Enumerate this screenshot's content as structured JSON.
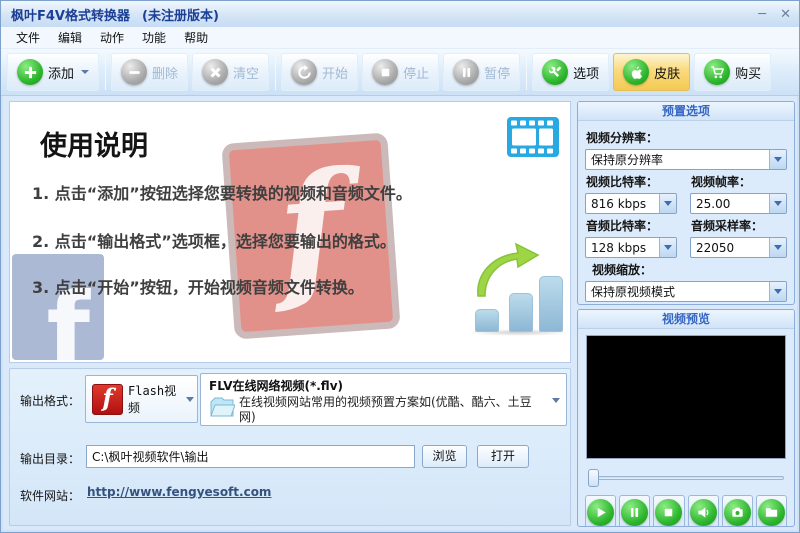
{
  "window": {
    "title": "枫叶F4V格式转换器",
    "title_suffix": "(未注册版本)",
    "minimize_glyph": "─",
    "close_glyph": "✕"
  },
  "menu": {
    "items": [
      "文件",
      "编辑",
      "动作",
      "功能",
      "帮助"
    ]
  },
  "toolbar": {
    "buttons": [
      {
        "label": "添加",
        "icon": "add-icon",
        "enabled": true,
        "dropdown": true
      },
      {
        "label": "删除",
        "icon": "remove-icon",
        "enabled": false
      },
      {
        "label": "清空",
        "icon": "clear-icon",
        "enabled": false
      },
      {
        "label": "开始",
        "icon": "start-icon",
        "enabled": false
      },
      {
        "label": "停止",
        "icon": "stop-icon",
        "enabled": false
      },
      {
        "label": "暂停",
        "icon": "pause-icon",
        "enabled": false
      },
      {
        "label": "选项",
        "icon": "options-icon",
        "enabled": true
      },
      {
        "label": "皮肤",
        "icon": "skin-icon",
        "enabled": true,
        "highlighted": true
      },
      {
        "label": "购买",
        "icon": "buy-icon",
        "enabled": true
      }
    ]
  },
  "instructions": {
    "heading": "使用说明",
    "steps": [
      "1. 点击“添加”按钮选择您要转换的视频和音频文件。",
      "2. 点击“输出格式”选项框，选择您要输出的格式。",
      "3. 点击“开始”按钮，开始视频音频文件转换。"
    ]
  },
  "presets": {
    "title": "预置选项",
    "resolution_label": "视频分辨率：",
    "resolution_value": "保持原分辨率",
    "video_bitrate_label": "视频比特率：",
    "video_bitrate_value": "816 kbps",
    "framerate_label": "视频帧率：",
    "framerate_value": "25.00",
    "audio_bitrate_label": "音频比特率：",
    "audio_bitrate_value": "128 kbps",
    "sample_rate_label": "音频采样率：",
    "sample_rate_value": "22050",
    "scale_label": "视频缩放：",
    "scale_value": "保持原视频模式"
  },
  "preview": {
    "title": "视频预览",
    "controls": [
      "play",
      "pause",
      "stop",
      "volume",
      "snapshot",
      "folder"
    ]
  },
  "output": {
    "format_label": "输出格式：",
    "format_value": "Flash视频",
    "preset_title": "FLV在线网络视频(*.flv)",
    "preset_desc": "在线视频网站常用的视频预置方案如(优酷、酷六、土豆网)",
    "dir_label": "输出目录：",
    "dir_value": "C:\\枫叶视频软件\\输出",
    "browse_label": "浏览",
    "open_label": "打开",
    "site_label": "软件网站：",
    "site_url": "http://www.fengyesoft.com"
  },
  "colors": {
    "accent_green": "#2db52d",
    "title_text": "#1c3e94",
    "group_header_text": "#3566c4",
    "skin_highlight": "#f4ca52",
    "flash_red": "#b01010"
  }
}
